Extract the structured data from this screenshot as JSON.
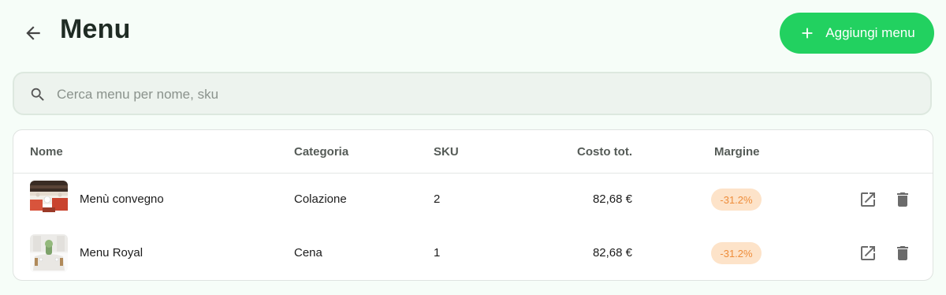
{
  "header": {
    "title": "Menu",
    "back_icon": "arrow-left-icon",
    "add_button": {
      "label": "Aggiungi menu",
      "icon": "plus-icon"
    }
  },
  "search": {
    "placeholder": "Cerca menu per nome, sku",
    "value": "",
    "icon": "search-icon"
  },
  "table": {
    "columns": [
      "Nome",
      "Categoria",
      "SKU",
      "Costo tot.",
      "Margine"
    ],
    "rows": [
      {
        "name": "Menù convegno",
        "category": "Colazione",
        "sku": "2",
        "cost": "82,68 €",
        "margin": "-31.2%"
      },
      {
        "name": "Menu Royal",
        "category": "Cena",
        "sku": "1",
        "cost": "82,68 €",
        "margin": "-31.2%"
      }
    ],
    "row_actions": [
      "open-external-icon",
      "trash-icon"
    ]
  },
  "colors": {
    "background": "#f6fdf8",
    "accent": "#22d160",
    "margin_badge_bg": "#fde3c9",
    "margin_badge_text": "#ee8d3a"
  }
}
